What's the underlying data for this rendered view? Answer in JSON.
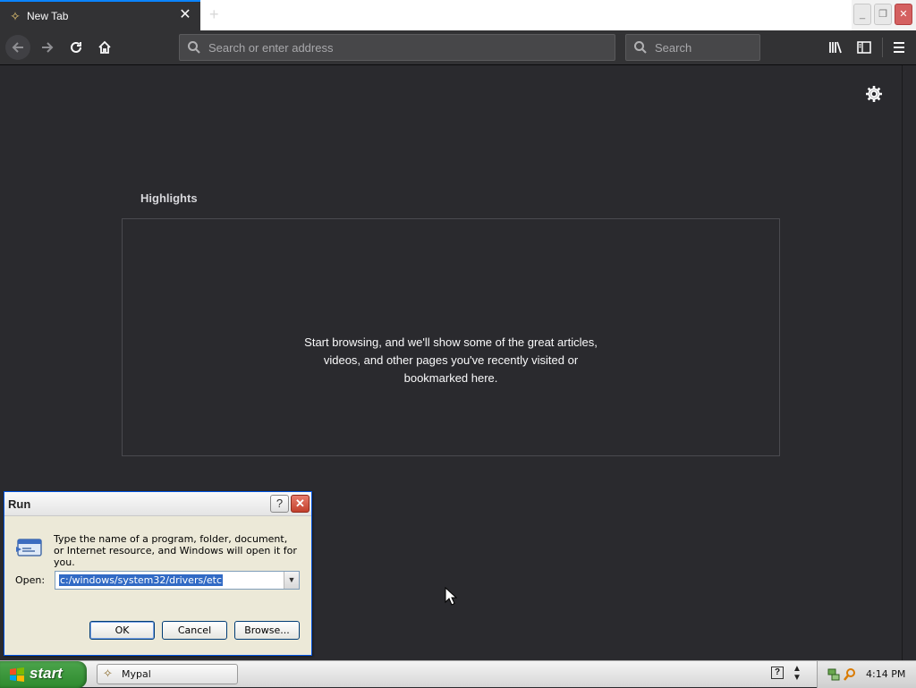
{
  "browser": {
    "tab_title": "New Tab",
    "tab_close": "✕",
    "new_tab_symbol": "+",
    "window_buttons": {
      "minimize": "_",
      "maximize": "❐",
      "close": "✕"
    },
    "address_placeholder": "Search or enter address",
    "search_placeholder": "Search"
  },
  "newtab": {
    "highlights_title": "Highlights",
    "empty_message_lines": [
      "Start browsing, and we'll show some of the great articles,",
      "videos, and other pages you've recently visited or",
      "bookmarked here."
    ]
  },
  "run_dialog": {
    "title": "Run",
    "help": "?",
    "close": "✕",
    "description": "Type the name of a program, folder, document, or Internet resource, and Windows will open it for you.",
    "open_label": "Open:",
    "open_value": "c:/windows/system32/drivers/etc",
    "dropdown_arrow": "▼",
    "ok_label": "OK",
    "cancel_label": "Cancel",
    "browse_label": "Browse..."
  },
  "taskbar": {
    "start_label": "start",
    "task_item_label": "Mypal",
    "help_symbol": "?",
    "clock": "4:14 PM"
  },
  "icons": {
    "tab_favicon": "mypal-icon",
    "back": "arrow-left-icon",
    "forward": "arrow-right-icon",
    "reload": "reload-icon",
    "home": "home-icon",
    "library": "library-icon",
    "sidebar": "sidebar-icon",
    "menu": "hamburger-menu-icon",
    "settings": "gear-icon",
    "run": "run-icon"
  },
  "colors": {
    "browser_chrome": "#323234",
    "content_bg": "#2a2a2e",
    "tab_accent": "#0a84ff",
    "start_green": "#3a9a3a",
    "selection": "#316ac5"
  }
}
